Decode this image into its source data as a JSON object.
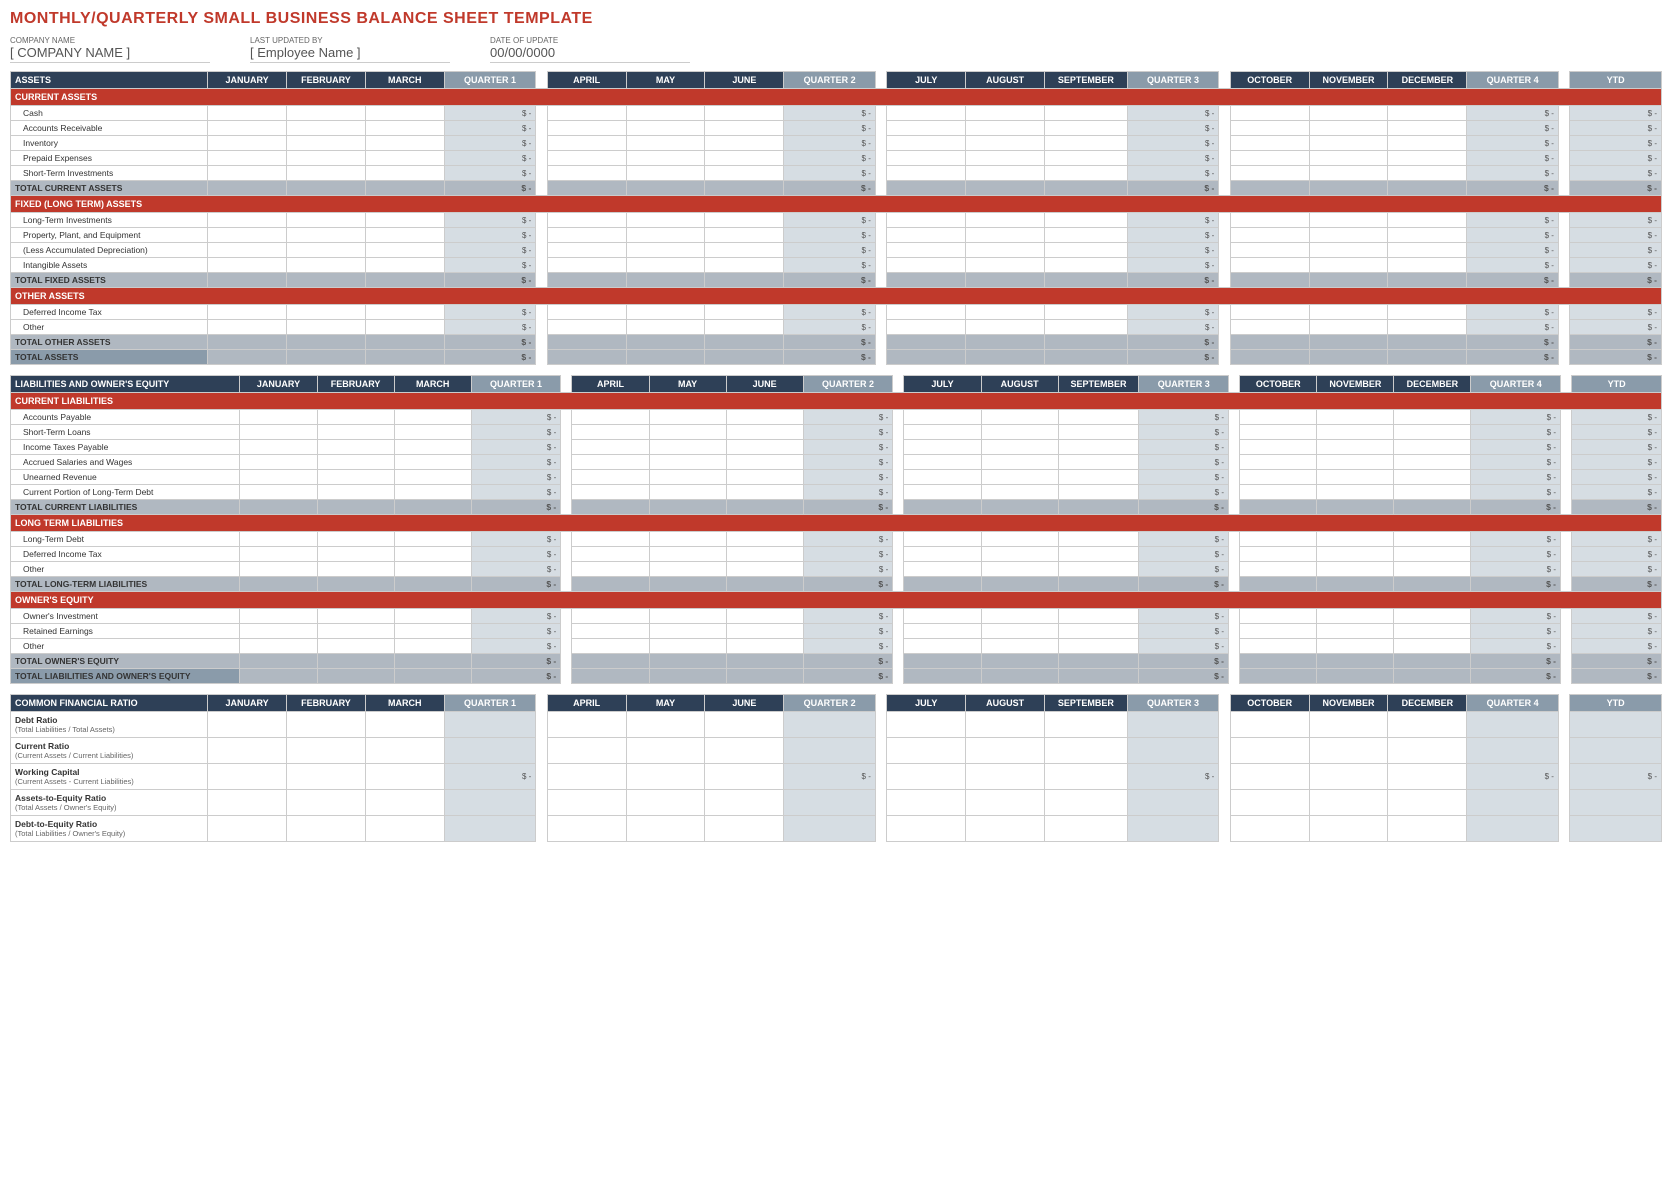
{
  "title": "MONTHLY/QUARTERLY SMALL BUSINESS BALANCE SHEET TEMPLATE",
  "company": {
    "name_label": "COMPANY NAME",
    "name_value": "[ COMPANY NAME ]",
    "updated_label": "LAST UPDATED BY",
    "updated_value": "[ Employee Name ]",
    "date_label": "DATE OF UPDATE",
    "date_value": "00/00/0000"
  },
  "headers": {
    "assets_col": "ASSETS",
    "liabilities_col": "LIABILITIES AND OWNER'S EQUITY",
    "ratio_col": "COMMON FINANCIAL RATIO",
    "january": "JANUARY",
    "february": "FEBRUARY",
    "march": "MARCH",
    "quarter1": "QUARTER 1",
    "april": "APRIL",
    "may": "MAY",
    "june": "JUNE",
    "quarter2": "QUARTER 2",
    "july": "JULY",
    "august": "AUGUST",
    "september": "SEPTEMBER",
    "quarter3": "QUARTER 3",
    "october": "OCTOBER",
    "november": "NOVEMBER",
    "december": "DECEMBER",
    "quarter4": "QUARTER 4",
    "ytd": "YTD"
  },
  "assets": {
    "section": "CURRENT ASSETS",
    "rows": [
      "Cash",
      "Accounts Receivable",
      "Inventory",
      "Prepaid Expenses",
      "Short-Term Investments"
    ],
    "total_current": "TOTAL CURRENT ASSETS",
    "fixed_section": "FIXED (LONG TERM) ASSETS",
    "fixed_rows": [
      "Long-Term Investments",
      "Property, Plant, and Equipment",
      "(Less Accumulated Depreciation)",
      "Intangible Assets"
    ],
    "total_fixed": "TOTAL FIXED ASSETS",
    "other_section": "OTHER ASSETS",
    "other_rows": [
      "Deferred Income Tax",
      "Other"
    ],
    "total_other": "TOTAL OTHER ASSETS",
    "grand_total": "TOTAL ASSETS"
  },
  "liabilities": {
    "current_section": "CURRENT LIABILITIES",
    "current_rows": [
      "Accounts Payable",
      "Short-Term Loans",
      "Income Taxes Payable",
      "Accrued Salaries and Wages",
      "Unearned Revenue",
      "Current Portion of Long-Term Debt"
    ],
    "total_current": "TOTAL CURRENT LIABILITIES",
    "longterm_section": "LONG TERM LIABILITIES",
    "longterm_rows": [
      "Long-Term Debt",
      "Deferred Income Tax",
      "Other"
    ],
    "total_longterm": "TOTAL LONG-TERM LIABILITIES",
    "equity_section": "OWNER'S EQUITY",
    "equity_rows": [
      "Owner's Investment",
      "Retained Earnings",
      "Other"
    ],
    "total_equity": "TOTAL OWNER'S EQUITY",
    "grand_total": "TOTAL LIABILITIES AND OWNER'S EQUITY"
  },
  "ratios": {
    "items": [
      {
        "label": "Debt Ratio",
        "sub": "(Total Liabilities / Total Assets)"
      },
      {
        "label": "Current Ratio",
        "sub": "(Current Assets / Current Liabilities)"
      },
      {
        "label": "Working Capital",
        "sub": "(Current Assets - Current Liabilities)"
      },
      {
        "label": "Assets-to-Equity Ratio",
        "sub": "(Total Assets / Owner's Equity)"
      },
      {
        "label": "Debt-to-Equity Ratio",
        "sub": "(Total Liabilities / Owner's Equity)"
      }
    ]
  },
  "dash": "-",
  "dollar": "$"
}
